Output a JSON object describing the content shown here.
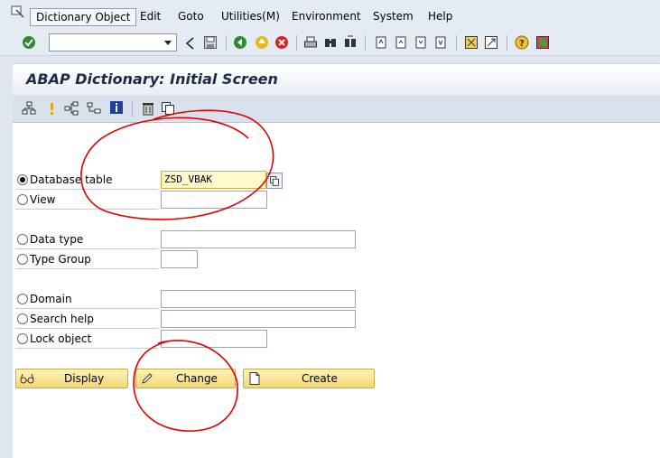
{
  "menu": {
    "items": [
      "Dictionary Object",
      "Edit",
      "Goto",
      "Utilities(M)",
      "Environment",
      "System",
      "Help"
    ]
  },
  "toolbar": {
    "command_field_value": ""
  },
  "title": "ABAP Dictionary: Initial Screen",
  "options": [
    {
      "label": "Database table",
      "value": "ZSD_VBAK",
      "selected": true
    },
    {
      "label": "View",
      "value": "",
      "selected": false
    },
    {
      "label": "Data type",
      "value": "",
      "selected": false
    },
    {
      "label": "Type Group",
      "value": "",
      "selected": false
    },
    {
      "label": "Domain",
      "value": "",
      "selected": false
    },
    {
      "label": "Search help",
      "value": "",
      "selected": false
    },
    {
      "label": "Lock object",
      "value": "",
      "selected": false
    }
  ],
  "buttons": {
    "display": "Display",
    "change": "Change",
    "create": "Create"
  },
  "colors": {
    "accent_button": "#f4d774",
    "annotation": "#e00000",
    "title_text": "#1b2c48"
  }
}
